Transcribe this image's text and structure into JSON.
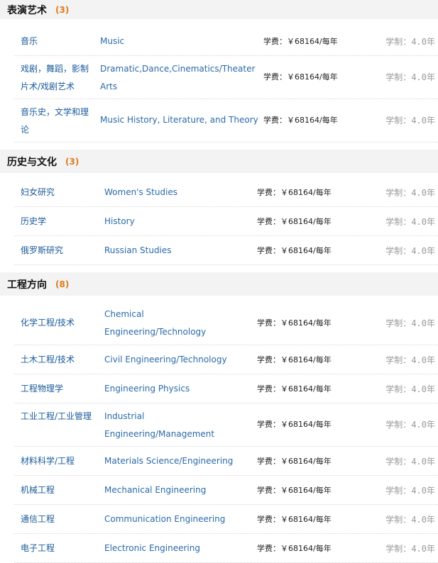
{
  "sections": [
    {
      "title": "表演艺术",
      "count": "(3)",
      "rows": [
        {
          "cn": "音乐",
          "en": "Music",
          "fee": "学费：￥68164/每年",
          "dur_label": "学制：",
          "dur_value": "4.0年"
        },
        {
          "cn": "戏剧，舞蹈，影制片术/戏剧艺术",
          "en": "Dramatic,Dance,Cinematics/Theater Arts",
          "fee": "学费：￥68164/每年",
          "dur_label": "学制：",
          "dur_value": "4.0年"
        },
        {
          "cn": "音乐史，文学和理论",
          "en": "Music History, Literature, and Theory",
          "fee": "学费：￥68164/每年",
          "dur_label": "学制：",
          "dur_value": "4.0年"
        }
      ]
    },
    {
      "title": "历史与文化",
      "count": "(3)",
      "rows": [
        {
          "cn": "妇女研究",
          "en": "Women's Studies",
          "fee": "学费：￥68164/每年",
          "dur_label": "学制：",
          "dur_value": "4.0年"
        },
        {
          "cn": "历史学",
          "en": "History",
          "fee": "学费：￥68164/每年",
          "dur_label": "学制：",
          "dur_value": "4.0年"
        },
        {
          "cn": "俄罗斯研究",
          "en": "Russian Studies",
          "fee": "学费：￥68164/每年",
          "dur_label": "学制：",
          "dur_value": "4.0年"
        }
      ]
    },
    {
      "title": "工程方向",
      "count": "(8)",
      "rows": [
        {
          "cn": "化学工程/技术",
          "en": "Chemical Engineering/Technology",
          "fee": "学费：￥68164/每年",
          "dur_label": "学制：",
          "dur_value": "4.0年"
        },
        {
          "cn": "土木工程/技术",
          "en": "Civil Engineering/Technology",
          "fee": "学费：￥68164/每年",
          "dur_label": "学制：",
          "dur_value": "4.0年"
        },
        {
          "cn": "工程物理学",
          "en": "Engineering Physics",
          "fee": "学费：￥68164/每年",
          "dur_label": "学制：",
          "dur_value": "4.0年"
        },
        {
          "cn": "工业工程/工业管理",
          "en": "Industrial Engineering/Management",
          "fee": "学费：￥68164/每年",
          "dur_label": "学制：",
          "dur_value": "4.0年"
        },
        {
          "cn": "材料科学/工程",
          "en": "Materials Science/Engineering",
          "fee": "学费：￥68164/每年",
          "dur_label": "学制：",
          "dur_value": "4.0年"
        },
        {
          "cn": "机械工程",
          "en": "Mechanical Engineering",
          "fee": "学费：￥68164/每年",
          "dur_label": "学制：",
          "dur_value": "4.0年"
        },
        {
          "cn": "通信工程",
          "en": "Communication Engineering",
          "fee": "学费：￥68164/每年",
          "dur_label": "学制：",
          "dur_value": "4.0年"
        },
        {
          "cn": "电子工程",
          "en": "Electronic Engineering",
          "fee": "学费：￥68164/每年",
          "dur_label": "学制：",
          "dur_value": "4.0年"
        }
      ]
    }
  ]
}
